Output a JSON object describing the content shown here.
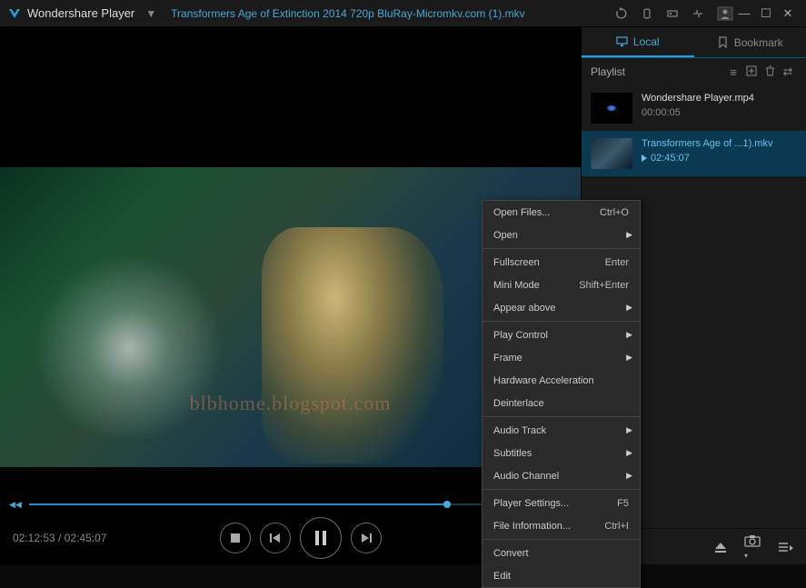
{
  "app": {
    "name": "Wondershare Player",
    "title": "Transformers Age of Extinction 2014 720p BluRay-Micromkv.com (1).mkv"
  },
  "watermark": "blbhome.blogspot.com",
  "playback": {
    "current_time": "02:12:53",
    "total_time": "02:45:07",
    "progress_pct": 80
  },
  "sidebar": {
    "tabs": {
      "local": "Local",
      "bookmark": "Bookmark"
    },
    "playlist_label": "Playlist",
    "items": [
      {
        "name": "Wondershare Player.mp4",
        "duration": "00:00:05",
        "active": false
      },
      {
        "name": "Transformers Age of ...1).mkv",
        "duration": "02:45:07",
        "active": true
      }
    ]
  },
  "context_menu": [
    {
      "type": "item",
      "label": "Open Files...",
      "shortcut": "Ctrl+O"
    },
    {
      "type": "submenu",
      "label": "Open"
    },
    {
      "type": "sep"
    },
    {
      "type": "item",
      "label": "Fullscreen",
      "shortcut": "Enter"
    },
    {
      "type": "item",
      "label": "Mini Mode",
      "shortcut": "Shift+Enter"
    },
    {
      "type": "submenu",
      "label": "Appear above"
    },
    {
      "type": "sep"
    },
    {
      "type": "submenu",
      "label": "Play Control"
    },
    {
      "type": "submenu",
      "label": "Frame"
    },
    {
      "type": "item",
      "label": "Hardware Acceleration"
    },
    {
      "type": "item",
      "label": "Deinterlace"
    },
    {
      "type": "sep"
    },
    {
      "type": "submenu",
      "label": "Audio Track"
    },
    {
      "type": "submenu",
      "label": "Subtitles"
    },
    {
      "type": "submenu",
      "label": "Audio Channel"
    },
    {
      "type": "sep"
    },
    {
      "type": "item",
      "label": "Player Settings...",
      "shortcut": "F5"
    },
    {
      "type": "item",
      "label": "File Information...",
      "shortcut": "Ctrl+I"
    },
    {
      "type": "sep"
    },
    {
      "type": "item",
      "label": "Convert"
    },
    {
      "type": "item",
      "label": "Edit"
    }
  ],
  "colors": {
    "accent": "#2a9ad8",
    "bg": "#1a1a1a"
  }
}
